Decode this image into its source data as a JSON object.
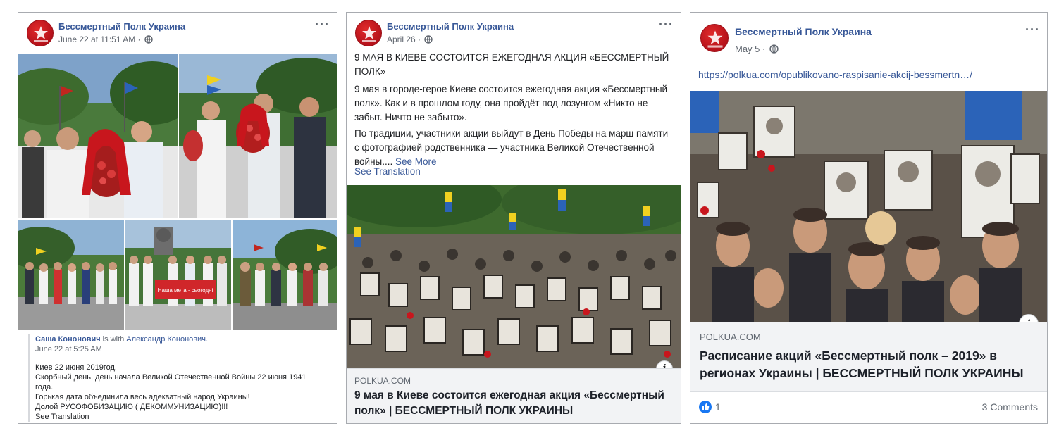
{
  "colors": {
    "accent": "#385898",
    "page_red": "#c8161d",
    "like_blue": "#1877f2"
  },
  "cards": [
    {
      "page_name": "Бессмертный Полк Украина",
      "date": "June 22 at 11:51 AM ·",
      "more": "···",
      "shared": {
        "author": "Саша Кононович",
        "with_text": " is with ",
        "with_name": "Александр Кононович.",
        "date": "June 22 at 5:25 AM",
        "lines": [
          "Киев 22 июня 2019год.",
          "Скорбный день, день начала Великой Отечественной Войны 22 июня 1941 года.",
          "Горькая дата объединила весь адекватный народ Украины!",
          "Долой РУСОФОБИЗАЦИЮ ( ДЕКОММУНИЗАЦИЮ)!!!"
        ],
        "see_translation": "See Translation"
      },
      "banner_text": "Наша мета - сьогодні"
    },
    {
      "page_name": "Бессмертный Полк Украина",
      "date": "April 26 ·",
      "more": "···",
      "headline": "9 МАЯ В КИЕВЕ СОСТОИТСЯ ЕЖЕГОДНАЯ АКЦИЯ «БЕССМЕРТНЫЙ ПОЛК»",
      "para1": "9 мая в городе-герое Киеве состоится ежегодная акция «Бессмертный полк». Как и в прошлом году, она пройдёт под лозунгом «Никто не забыт. Ничто не забыто».",
      "para2": "По традиции, участники акции выйдут в День Победы на марш памяти с фотографией родственника — участника Великой Отечественной войны....",
      "see_more": "See More",
      "see_translation": "See Translation",
      "link_domain": "POLKUA.COM",
      "link_title": "9 мая в Киеве состоится ежегодная акция «Бессмертный полк» | БЕССМЕРТНЫЙ ПОЛК УКРАИНЫ",
      "info": "i"
    },
    {
      "page_name": "Бессмертный Полк Украина",
      "date": "May 5 ·",
      "more": "···",
      "url": "https://polkua.com/opublikovano-raspisanie-akcij-bessmertn…/",
      "link_domain": "POLKUA.COM",
      "link_title": "Расписание акций «Бессмертный полк – 2019» в регионах Украины | БЕССМЕРТНЫЙ ПОЛК УКРАИНЫ",
      "info": "i",
      "likes": "1",
      "comments": "3 Comments"
    }
  ]
}
